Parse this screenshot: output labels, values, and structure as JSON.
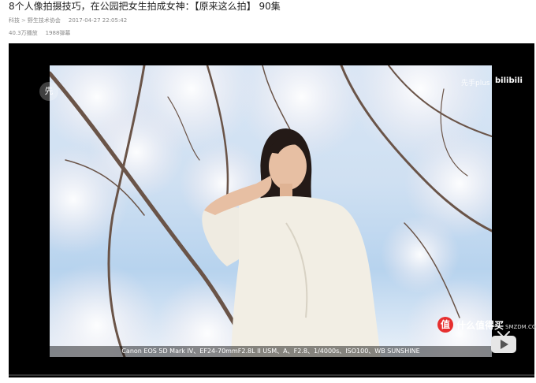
{
  "video": {
    "title": "8个人像拍摄技巧，在公园把女生拍成女神：【原来这么拍】 90集",
    "category": "科技",
    "subcategory": "野生技术协会",
    "published": "2017-04-27 22:05:42",
    "views": "40.3万播放",
    "danmaku": "1988弹幕"
  },
  "player": {
    "caption": "Canon EOS 5D Mark IV、EF24-70mmF2.8L II USM、A、F2.8、1/4000s、ISO100、WB SUNSHINE",
    "channel_watermark": "先手plus",
    "bilibili_watermark": "bilibili",
    "channel_logo_char": "先",
    "play_icon": "tv-play-icon"
  },
  "site_brand": {
    "logo_char": "值",
    "name": "什么值得买",
    "url": "SMZDM.COM"
  }
}
